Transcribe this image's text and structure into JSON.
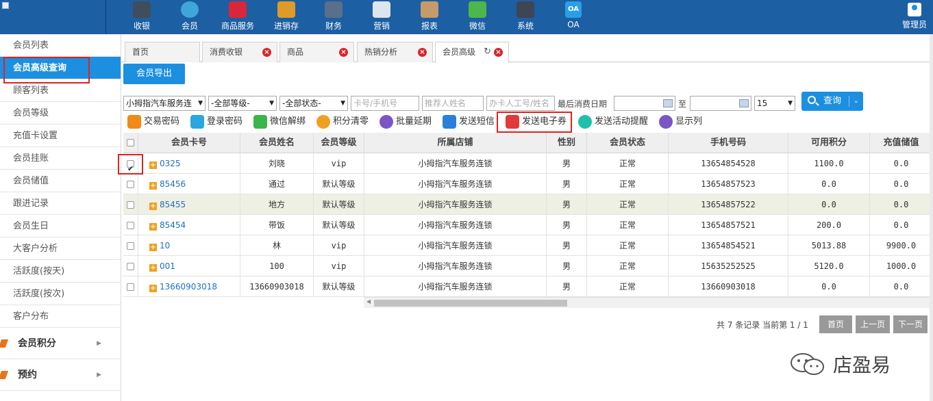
{
  "topnav": [
    {
      "label": "收银",
      "icon": "cash-register-icon",
      "color": "#3f4d5c"
    },
    {
      "label": "会员",
      "icon": "member-icon",
      "color": "#3fa6d9"
    },
    {
      "label": "商品服务",
      "icon": "product-service-icon",
      "color": "#d9263a"
    },
    {
      "label": "进销存",
      "icon": "inventory-icon",
      "color": "#e09a28"
    },
    {
      "label": "财务",
      "icon": "finance-icon",
      "color": "#5a6f8a"
    },
    {
      "label": "营销",
      "icon": "marketing-icon",
      "color": "#dce6ef"
    },
    {
      "label": "报表",
      "icon": "report-icon",
      "color": "#c79a6a"
    },
    {
      "label": "微信",
      "icon": "wechat-icon",
      "color": "#4cb84c"
    },
    {
      "label": "系统",
      "icon": "system-icon",
      "color": "#3d4652"
    },
    {
      "label": "OA",
      "icon": "oa-icon",
      "color": "#2a9fe8"
    }
  ],
  "admin_label": "管理员",
  "sidebar": {
    "items": [
      "会员列表",
      "会员高级查询",
      "顾客列表",
      "会员等级",
      "充值卡设置",
      "会员挂账",
      "会员储值",
      "跟进记录",
      "会员生日",
      "大客户分析",
      "活跃度(按天)",
      "活跃度(按次)",
      "客户分布"
    ],
    "active_index": 1,
    "groups": [
      "会员积分",
      "预约"
    ]
  },
  "tabs": [
    {
      "label": "首页",
      "closable": false
    },
    {
      "label": "消费收银",
      "closable": true
    },
    {
      "label": "商品",
      "closable": true
    },
    {
      "label": "热销分析",
      "closable": true
    },
    {
      "label": "会员高级",
      "closable": true,
      "active": true
    }
  ],
  "export_label": "会员导出",
  "filters": {
    "store": "小拇指汽车服务连",
    "level": "-全部等级-",
    "status": "-全部状态-",
    "card_placeholder": "卡号/手机号",
    "referrer_placeholder": "推荐人姓名",
    "staff_placeholder": "办卡人工号/姓名",
    "last_consume_label": "最后消费日期",
    "to_label": "至",
    "page_size": "15",
    "query_label": "查询"
  },
  "toolbar": [
    {
      "label": "交易密码",
      "icon": "key-icon",
      "color": "#f08a18"
    },
    {
      "label": "登录密码",
      "icon": "lock-icon",
      "color": "#2aa6e0"
    },
    {
      "label": "微信解绑",
      "icon": "link-icon",
      "color": "#3cb54a"
    },
    {
      "label": "积分清零",
      "icon": "points-icon",
      "color": "#f0a020"
    },
    {
      "label": "批量延期",
      "icon": "clock-icon",
      "color": "#7b55c7"
    },
    {
      "label": "发送短信",
      "icon": "mail-icon",
      "color": "#2a7fd9"
    },
    {
      "label": "发送电子券",
      "icon": "paper-plane-icon",
      "color": "#e03a3a"
    },
    {
      "label": "发送活动提醒",
      "icon": "alarm-icon",
      "color": "#1fc1a8"
    },
    {
      "label": "显示列",
      "icon": "columns-icon",
      "color": "#7b55c7"
    }
  ],
  "table": {
    "columns": [
      "会员卡号",
      "会员姓名",
      "会员等级",
      "所属店铺",
      "性别",
      "会员状态",
      "手机号码",
      "可用积分",
      "充值储值"
    ],
    "rows": [
      {
        "checked": true,
        "card": "0325",
        "name": "刘晓",
        "level": "vip",
        "store": "小拇指汽车服务连锁",
        "gender": "男",
        "status": "正常",
        "phone": "13654854528",
        "points": "1100.0",
        "balance": "0.0"
      },
      {
        "checked": false,
        "card": "85456",
        "name": "通过",
        "level": "默认等级",
        "store": "小拇指汽车服务连锁",
        "gender": "男",
        "status": "正常",
        "phone": "13654857523",
        "points": "0.0",
        "balance": "0.0"
      },
      {
        "checked": false,
        "card": "85455",
        "name": "地方",
        "level": "默认等级",
        "store": "小拇指汽车服务连锁",
        "gender": "男",
        "status": "正常",
        "phone": "13654857522",
        "points": "0.0",
        "balance": "0.0",
        "highlight": true
      },
      {
        "checked": false,
        "card": "85454",
        "name": "带饭",
        "level": "默认等级",
        "store": "小拇指汽车服务连锁",
        "gender": "男",
        "status": "正常",
        "phone": "13654857521",
        "points": "200.0",
        "balance": "0.0"
      },
      {
        "checked": false,
        "card": "10",
        "name": "林",
        "level": "vip",
        "store": "小拇指汽车服务连锁",
        "gender": "男",
        "status": "正常",
        "phone": "13654854521",
        "points": "5013.88",
        "balance": "9900.0"
      },
      {
        "checked": false,
        "card": "001",
        "name": "100",
        "level": "vip",
        "store": "小拇指汽车服务连锁",
        "gender": "男",
        "status": "正常",
        "phone": "15635252525",
        "points": "5120.0",
        "balance": "1000.0"
      },
      {
        "checked": false,
        "card": "13660903018",
        "name": "13660903018",
        "level": "默认等级",
        "store": "小拇指汽车服务连锁",
        "gender": "男",
        "status": "正常",
        "phone": "13660903018",
        "points": "0.0",
        "balance": "0.0"
      }
    ]
  },
  "pager": {
    "info": "共 7 条记录 当前第 1 / 1",
    "first": "首页",
    "prev": "上一页",
    "next": "下一页"
  },
  "watermark": "店盈易",
  "colors": {
    "topbar": "#1c5fa3",
    "accent": "#1c8fe0",
    "highlight_box": "#e02020"
  }
}
